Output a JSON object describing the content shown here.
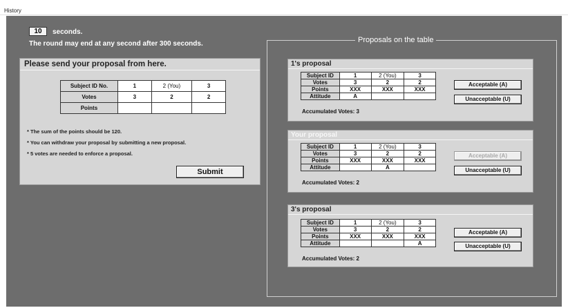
{
  "menu": {
    "title": "History"
  },
  "timer": {
    "value": "10",
    "unit": "seconds.",
    "notice": "The round may end at any second after 300 seconds."
  },
  "send_panel": {
    "title": "Please send your proposal from here.",
    "table": {
      "header": [
        "Subject ID No.",
        "1",
        "2 (You)",
        "3"
      ],
      "votes_label": "Votes",
      "votes": [
        "3",
        "2",
        "2"
      ],
      "points_label": "Points",
      "points": [
        "",
        "",
        ""
      ]
    },
    "notes": [
      "* The sum of the points should be 120.",
      "* You can withdraw your proposal by submitting a new proposal.",
      "* 5 votes are needed to enforce a proposal."
    ],
    "submit_label": "Submit"
  },
  "proposals_section": {
    "title": "Proposals on the table",
    "proposals": [
      {
        "title": "1's proposal",
        "header": [
          "Subject ID",
          "1",
          "2 (You)",
          "3"
        ],
        "votes_label": "Votes",
        "votes": [
          "3",
          "2",
          "2"
        ],
        "points_label": "Points",
        "points": [
          "XXX",
          "XXX",
          "XXX"
        ],
        "attitude_label": "Attitude",
        "attitude": [
          "A",
          "",
          ""
        ],
        "accumulated": "Accumulated Votes:   3",
        "acceptable_label": "Acceptable (A)",
        "unacceptable_label": "Unacceptable (U)"
      },
      {
        "title": "Your proposal",
        "header": [
          "Subject ID",
          "1",
          "2 (You)",
          "3"
        ],
        "votes_label": "Votes",
        "votes": [
          "3",
          "2",
          "2"
        ],
        "points_label": "Points",
        "points": [
          "XXX",
          "XXX",
          "XXX"
        ],
        "attitude_label": "Attitude",
        "attitude": [
          "",
          "A",
          ""
        ],
        "accumulated": "Accumulated Votes:   2",
        "acceptable_label": "Acceptable (A)",
        "unacceptable_label": "Unacceptable (U)"
      },
      {
        "title": "3's proposal",
        "header": [
          "Subject ID",
          "1",
          "2 (You)",
          "3"
        ],
        "votes_label": "Votes",
        "votes": [
          "3",
          "2",
          "2"
        ],
        "points_label": "Points",
        "points": [
          "XXX",
          "XXX",
          "XXX"
        ],
        "attitude_label": "Attitude",
        "attitude": [
          "",
          "",
          "A"
        ],
        "accumulated": "Accumulated Votes:   2",
        "acceptable_label": "Acceptable (A)",
        "unacceptable_label": "Unacceptable (U)"
      }
    ]
  }
}
